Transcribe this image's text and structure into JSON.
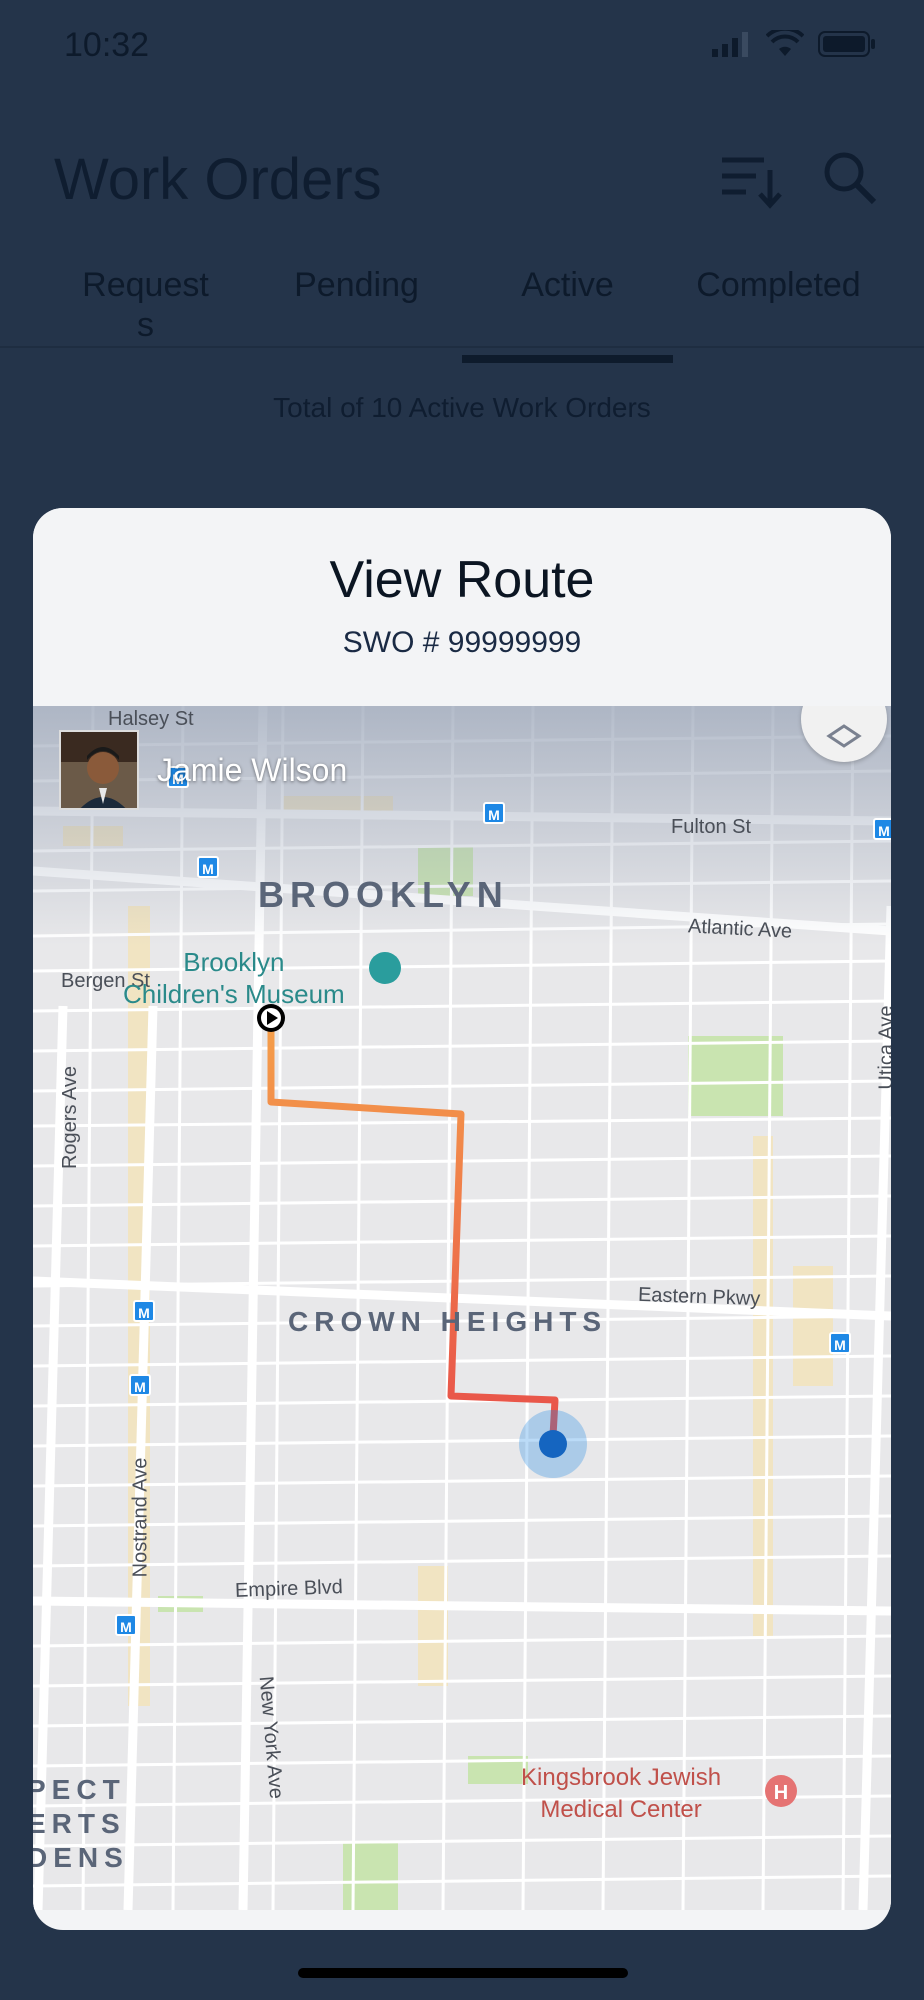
{
  "status": {
    "time": "10:32"
  },
  "header": {
    "title": "Work Orders",
    "sort_icon": "sort-descending-icon",
    "search_icon": "search-icon"
  },
  "tabs": [
    {
      "label": "Request\ns",
      "active": false
    },
    {
      "label": "Pending",
      "active": false
    },
    {
      "label": "Active",
      "active": true
    },
    {
      "label": "Completed",
      "active": false
    }
  ],
  "summary": "Total of 10 Active Work Orders",
  "modal": {
    "title": "View Route",
    "subtitle": "SWO # 99999999"
  },
  "map": {
    "driver_name": "Jamie Wilson",
    "districts": [
      "BROOKLYN",
      "CROWN HEIGHTS",
      "PECT",
      "ERTS",
      "DENS"
    ],
    "streets": [
      "Halsey St",
      "Fulton St",
      "Atlantic Ave",
      "Bergen St",
      "Rogers Ave",
      "Eastern Pkwy",
      "Nostrand Ave",
      "Empire Blvd",
      "New York Ave",
      "Utica Ave"
    ],
    "poi_museum": "Brooklyn Children's Museum",
    "poi_museum_line1": "Brooklyn",
    "poi_museum_line2": "Children's Museum",
    "poi_hospital_line1": "Kingsbrook Jewish",
    "poi_hospital_line2": "Medical Center",
    "route_start_color": "#f5a04a",
    "route_end_color": "#e8504a",
    "location_dot_color": "#1565c0",
    "metro_symbol": "M"
  }
}
